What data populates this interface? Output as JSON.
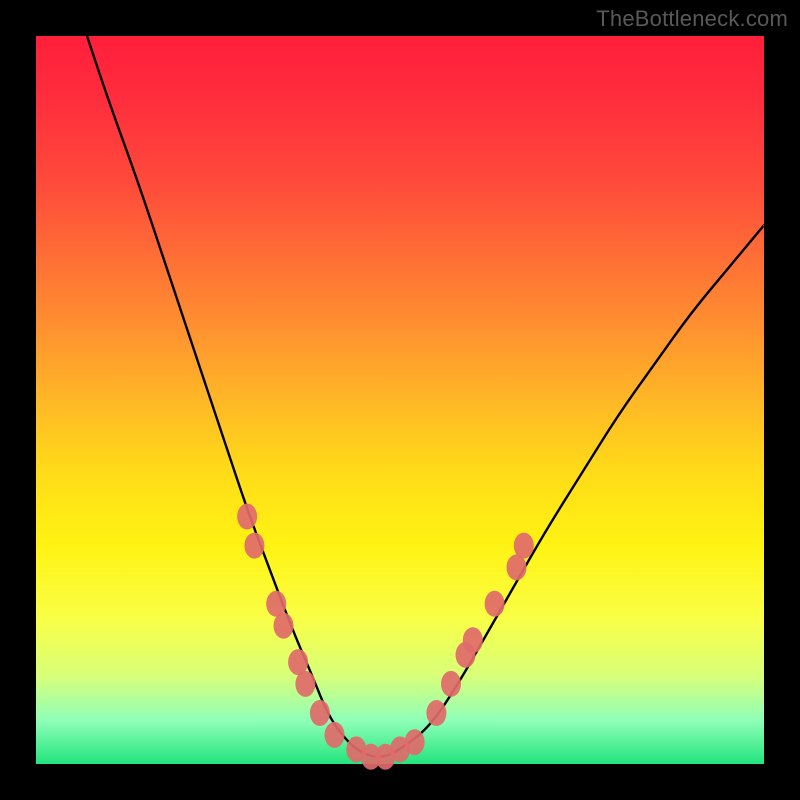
{
  "watermark": "TheBottleneck.com",
  "colors": {
    "page_bg": "#000000",
    "watermark": "#595959",
    "curve": "#000000",
    "markers": "#e06a6a",
    "gradient_top": "#ff1f3a",
    "gradient_bottom": "#23e47e"
  },
  "chart_data": {
    "type": "line",
    "title": "",
    "xlabel": "",
    "ylabel": "",
    "xlim": [
      0,
      100
    ],
    "ylim": [
      0,
      100
    ],
    "grid": false,
    "legend": false,
    "note": "Axes are unlabeled in the source image; values are estimated percentages of the plot area (0=left/bottom, 100=right/top).",
    "series": [
      {
        "name": "bottleneck-curve",
        "x": [
          7,
          10,
          14,
          18,
          22,
          26,
          29,
          32,
          35,
          38,
          40,
          42,
          44,
          46,
          48,
          50,
          54,
          58,
          62,
          66,
          70,
          75,
          80,
          85,
          90,
          95,
          100
        ],
        "y": [
          100,
          91,
          80,
          68,
          56,
          44,
          35,
          27,
          19,
          12,
          7,
          4,
          2,
          1,
          1,
          2,
          5,
          11,
          18,
          25,
          32,
          40,
          48,
          55,
          62,
          68,
          74
        ]
      }
    ],
    "markers": {
      "name": "highlighted-points",
      "color": "#e06a6a",
      "points": [
        {
          "x": 29,
          "y": 34
        },
        {
          "x": 30,
          "y": 30
        },
        {
          "x": 33,
          "y": 22
        },
        {
          "x": 34,
          "y": 19
        },
        {
          "x": 36,
          "y": 14
        },
        {
          "x": 37,
          "y": 11
        },
        {
          "x": 39,
          "y": 7
        },
        {
          "x": 41,
          "y": 4
        },
        {
          "x": 44,
          "y": 2
        },
        {
          "x": 46,
          "y": 1
        },
        {
          "x": 48,
          "y": 1
        },
        {
          "x": 50,
          "y": 2
        },
        {
          "x": 52,
          "y": 3
        },
        {
          "x": 55,
          "y": 7
        },
        {
          "x": 57,
          "y": 11
        },
        {
          "x": 59,
          "y": 15
        },
        {
          "x": 60,
          "y": 17
        },
        {
          "x": 63,
          "y": 22
        },
        {
          "x": 66,
          "y": 27
        },
        {
          "x": 67,
          "y": 30
        }
      ]
    }
  }
}
